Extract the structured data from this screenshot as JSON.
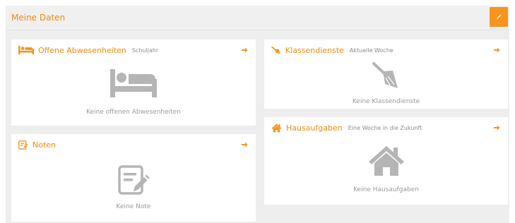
{
  "header": {
    "title": "Meine Daten",
    "edit_icon": "pencil-icon"
  },
  "colors": {
    "accent": "#f7941d",
    "title_text": "#f08a0c",
    "muted_text": "#9a9a9a",
    "icon_gray": "#b5b5b5",
    "panel_bg": "#eeeeee"
  },
  "cards": {
    "absences": {
      "title": "Offene Abwesenheiten",
      "subtitle": "Schuljahr",
      "empty_text": "Keine offenen Abwesenheiten",
      "icon": "bed-icon"
    },
    "duties": {
      "title": "Klassendienste",
      "subtitle": "Aktuelle Woche",
      "empty_text": "Keine Klassendienste",
      "icon": "broom-icon"
    },
    "homework": {
      "title": "Hausaufgaben",
      "subtitle": "Eine Woche in die Zukunft",
      "empty_text": "Keine Hausaufgaben",
      "icon": "house-icon"
    },
    "grades": {
      "title": "Noten",
      "subtitle": "",
      "empty_text": "Keine Note",
      "icon": "edit-note-icon"
    }
  }
}
